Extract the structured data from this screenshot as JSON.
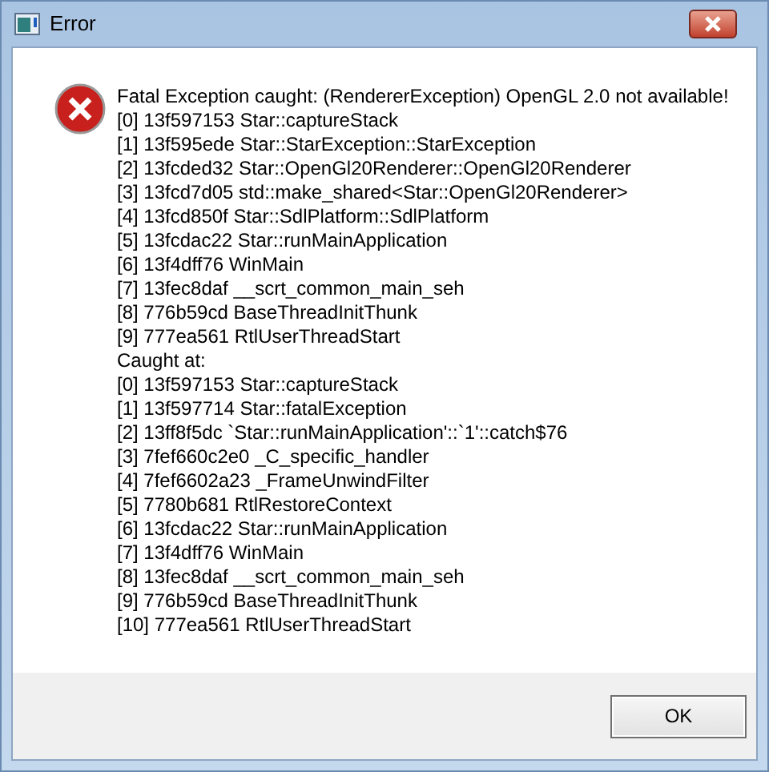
{
  "window": {
    "title": "Error"
  },
  "message_lines": [
    "Fatal Exception caught: (RendererException) OpenGL 2.0 not available!",
    "[0] 13f597153 Star::captureStack",
    "[1] 13f595ede Star::StarException::StarException",
    "[2] 13fcded32 Star::OpenGl20Renderer::OpenGl20Renderer",
    "[3] 13fcd7d05 std::make_shared<Star::OpenGl20Renderer>",
    "[4] 13fcd850f Star::SdlPlatform::SdlPlatform",
    "[5] 13fcdac22 Star::runMainApplication",
    "[6] 13f4dff76 WinMain",
    "[7] 13fec8daf __scrt_common_main_seh",
    "[8] 776b59cd BaseThreadInitThunk",
    "[9] 777ea561 RtlUserThreadStart",
    "Caught at:",
    "[0] 13f597153 Star::captureStack",
    "[1] 13f597714 Star::fatalException",
    "[2] 13ff8f5dc `Star::runMainApplication'::`1'::catch$76",
    "[3] 7fef660c2e0 _C_specific_handler",
    "[4] 7fef6602a23 _FrameUnwindFilter",
    "[5] 7780b681 RtlRestoreContext",
    "[6] 13fcdac22 Star::runMainApplication",
    "[7] 13f4dff76 WinMain",
    "[8] 13fec8daf __scrt_common_main_seh",
    "[9] 776b59cd BaseThreadInitThunk",
    "[10] 777ea561 RtlUserThreadStart"
  ],
  "buttons": [
    "OK"
  ]
}
